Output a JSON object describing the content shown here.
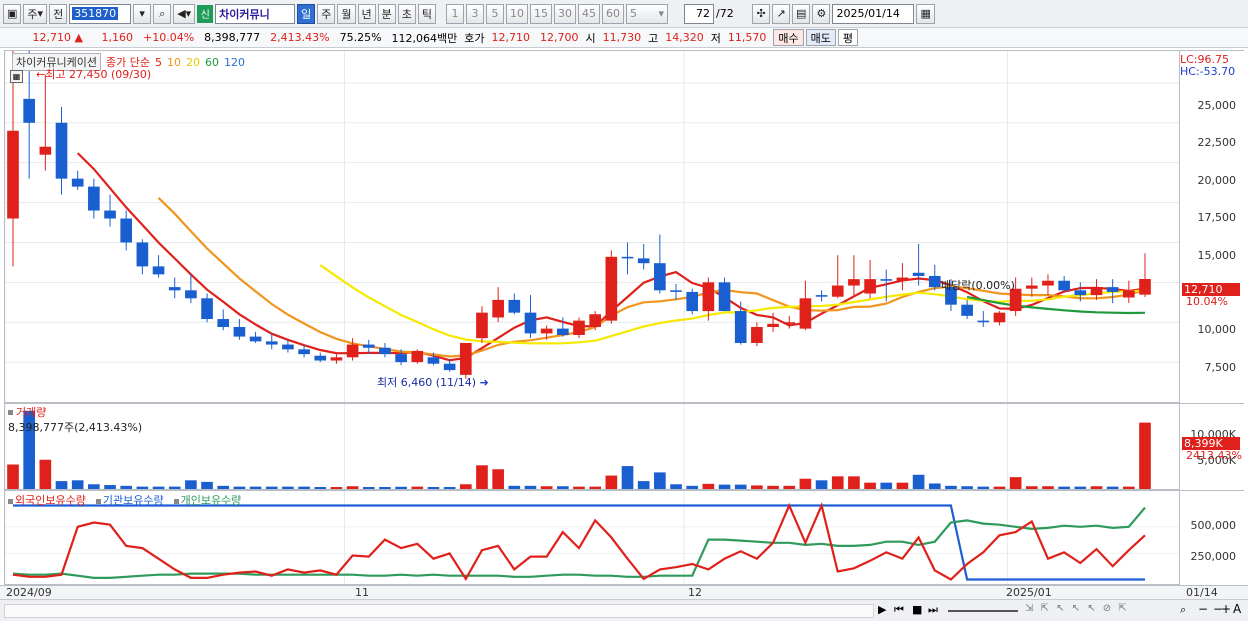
{
  "toolbar": {
    "market": "주",
    "prev": "전",
    "code": "351870",
    "new_badge": "신",
    "stock_name": "차이커뮤니",
    "periods": [
      "일",
      "주",
      "월",
      "년",
      "분",
      "초",
      "틱"
    ],
    "active_period": "일",
    "intervals": [
      "1",
      "3",
      "5",
      "10",
      "15",
      "30",
      "45",
      "60"
    ],
    "interval_select": "5",
    "count": "72",
    "count_total": "/72",
    "date": "2025/01/14"
  },
  "quote": {
    "price": "12,710",
    "change": "1,160",
    "change_pct": "+10.04%",
    "volume": "8,398,777",
    "volume_ratio": "2,413.43%",
    "turnover": "75.25%",
    "amount": "112,064백만",
    "hoga_label": "호가",
    "ask": "12,710",
    "bid": "12,700",
    "open_label": "시",
    "open": "11,730",
    "high_label": "고",
    "high": "14,320",
    "low_label": "저",
    "low": "11,570",
    "buy": "매수",
    "sell": "매도",
    "avg": "평"
  },
  "main_panel": {
    "stock_name": "차이커뮤니케이션",
    "legend_prefix": "종가 단순",
    "ma_periods": [
      "5",
      "10",
      "20",
      "60",
      "120"
    ],
    "ma_colors": [
      "#e0201a",
      "#f0961e",
      "#f5e900",
      "#1e9a3c",
      "#2a6fd6"
    ],
    "high_note": "←최고 27,450 (09/30)",
    "low_note": "최저 6,460 (11/14)",
    "dividend_note": "배당락(0.00%)",
    "lc": "LC:96.75",
    "hc": "HC:-53.70",
    "price_tag": "12,710",
    "pct_tag": "10.04%",
    "y_ticks": [
      "25,000",
      "22,500",
      "20,000",
      "17,500",
      "15,000",
      "12,500",
      "10,000",
      "7,500"
    ]
  },
  "volume_panel": {
    "title": "거래량",
    "current": "8,398,777주(2,413.43%)",
    "tick": "10,000K",
    "tick2": "5,000K",
    "tag_value": "8,399K",
    "tag_pct": "2413.43%"
  },
  "holding_panel": {
    "legends": [
      "외국인보유수량",
      "기관보유수량",
      "개인보유수량"
    ],
    "legend_colors": [
      "#e0201a",
      "#1e5fd6",
      "#2e9a5c"
    ],
    "y_ticks": [
      "500,000",
      "250,000"
    ]
  },
  "x_axis": {
    "labels": [
      "2024/09",
      "11",
      "12",
      "2025/01"
    ],
    "right_label": "01/14"
  },
  "chart_data": {
    "type": "candlestick",
    "title": "차이커뮤니케이션",
    "ylim": [
      5000,
      27000
    ],
    "candles": [
      [
        16500,
        27450,
        13500,
        22000
      ],
      [
        24000,
        27000,
        19000,
        22500
      ],
      [
        20500,
        25500,
        19500,
        21000
      ],
      [
        22500,
        23500,
        18000,
        19000
      ],
      [
        19000,
        19500,
        18300,
        18500
      ],
      [
        18500,
        19000,
        16500,
        17000
      ],
      [
        17000,
        18000,
        16000,
        16500
      ],
      [
        16500,
        17000,
        14500,
        15000
      ],
      [
        15000,
        15200,
        13000,
        13500
      ],
      [
        13500,
        14200,
        12800,
        13000
      ],
      [
        12200,
        12800,
        11500,
        12000
      ],
      [
        12000,
        13000,
        11200,
        11500
      ],
      [
        11500,
        11800,
        10000,
        10200
      ],
      [
        10200,
        10800,
        9500,
        9700
      ],
      [
        9700,
        10200,
        8900,
        9100
      ],
      [
        9100,
        9400,
        8700,
        8800
      ],
      [
        8800,
        9300,
        8300,
        8600
      ],
      [
        8600,
        8900,
        8100,
        8300
      ],
      [
        8300,
        8600,
        7800,
        8000
      ],
      [
        7900,
        8100,
        7500,
        7600
      ],
      [
        7600,
        8000,
        7400,
        7800
      ],
      [
        7800,
        9000,
        7600,
        8600
      ],
      [
        8600,
        8900,
        8000,
        8400
      ],
      [
        8400,
        8700,
        7800,
        8000
      ],
      [
        8000,
        8300,
        7300,
        7500
      ],
      [
        7500,
        8300,
        7400,
        8200
      ],
      [
        7800,
        8100,
        7300,
        7400
      ],
      [
        7400,
        7700,
        6900,
        7000
      ],
      [
        6700,
        8700,
        6460,
        8700
      ],
      [
        9000,
        11000,
        8700,
        10600
      ],
      [
        10300,
        12200,
        10000,
        11400
      ],
      [
        11400,
        11800,
        10500,
        10600
      ],
      [
        10600,
        11700,
        9000,
        9300
      ],
      [
        9300,
        9800,
        8900,
        9600
      ],
      [
        9600,
        10300,
        9100,
        9200
      ],
      [
        9200,
        10300,
        9000,
        10100
      ],
      [
        9700,
        10700,
        9500,
        10500
      ],
      [
        10100,
        14500,
        9900,
        14100
      ],
      [
        14100,
        15000,
        13000,
        14000
      ],
      [
        14000,
        14900,
        13300,
        13700
      ],
      [
        13700,
        15500,
        11800,
        12000
      ],
      [
        12000,
        12400,
        11400,
        11900
      ],
      [
        11900,
        12100,
        10500,
        10700
      ],
      [
        10700,
        12800,
        10100,
        12500
      ],
      [
        12500,
        12800,
        10700,
        10700
      ],
      [
        10700,
        11300,
        8600,
        8700
      ],
      [
        8700,
        10000,
        8500,
        9700
      ],
      [
        9700,
        10600,
        9400,
        9900
      ],
      [
        9900,
        10400,
        9600,
        10000
      ],
      [
        9600,
        12600,
        9500,
        11500
      ],
      [
        11700,
        12000,
        11300,
        11600
      ],
      [
        11600,
        14200,
        11500,
        12300
      ],
      [
        12300,
        14200,
        11700,
        12700
      ],
      [
        11800,
        13900,
        11500,
        12700
      ],
      [
        12700,
        13300,
        11300,
        12600
      ],
      [
        12600,
        13700,
        12000,
        12800
      ],
      [
        13100,
        14900,
        12300,
        12900
      ],
      [
        12900,
        13600,
        12000,
        12200
      ],
      [
        12200,
        12700,
        10700,
        11100
      ],
      [
        11100,
        11400,
        10200,
        10400
      ],
      [
        10100,
        10700,
        9700,
        10000
      ],
      [
        10000,
        10700,
        9800,
        10600
      ],
      [
        10700,
        12800,
        10400,
        12100
      ],
      [
        12100,
        12800,
        11600,
        12300
      ],
      [
        12300,
        13000,
        11700,
        12600
      ],
      [
        12600,
        12900,
        11900,
        12000
      ],
      [
        12000,
        12500,
        11300,
        11700
      ],
      [
        11700,
        12700,
        11400,
        12200
      ],
      [
        12200,
        12700,
        11200,
        11900
      ],
      [
        11550,
        12600,
        11200,
        12000
      ],
      [
        11730,
        14320,
        11570,
        12710
      ]
    ],
    "volume": [
      3100,
      9900,
      3700,
      1000,
      1100,
      600,
      500,
      400,
      300,
      300,
      300,
      1100,
      900,
      400,
      300,
      300,
      300,
      300,
      300,
      250,
      250,
      350,
      250,
      250,
      280,
      300,
      250,
      250,
      600,
      3000,
      2500,
      400,
      400,
      350,
      350,
      300,
      300,
      1700,
      2900,
      1000,
      2100,
      600,
      400,
      650,
      550,
      550,
      450,
      400,
      400,
      1300,
      1100,
      1600,
      1600,
      800,
      800,
      800,
      1800,
      700,
      400,
      350,
      300,
      300,
      1500,
      350,
      350,
      300,
      300,
      350,
      300,
      300,
      8399
    ],
    "holding": {
      "foreign": [
        50,
        30,
        30,
        50,
        500,
        540,
        520,
        320,
        300,
        200,
        100,
        20,
        20,
        50,
        70,
        80,
        40,
        100,
        70,
        90,
        50,
        230,
        220,
        380,
        300,
        340,
        200,
        250,
        10,
        280,
        320,
        100,
        220,
        220,
        450,
        300,
        560,
        400,
        200,
        10,
        100,
        120,
        150,
        100,
        200,
        270,
        200,
        350,
        700,
        350,
        700,
        80,
        110,
        180,
        260,
        200,
        400,
        90,
        5,
        150,
        260,
        420,
        450,
        550,
        200,
        260,
        160,
        290,
        130,
        280,
        420
      ],
      "institution": [
        700,
        700,
        700,
        700,
        700,
        700,
        700,
        700,
        700,
        700,
        700,
        700,
        700,
        700,
        700,
        700,
        700,
        700,
        700,
        700,
        700,
        700,
        700,
        700,
        700,
        700,
        700,
        700,
        700,
        700,
        700,
        700,
        700,
        700,
        700,
        700,
        700,
        700,
        700,
        700,
        700,
        700,
        700,
        700,
        700,
        700,
        700,
        700,
        700,
        700,
        700,
        700,
        700,
        700,
        700,
        700,
        700,
        700,
        700,
        5,
        5,
        5,
        5,
        5,
        5,
        5,
        5,
        5,
        5,
        5,
        5
      ],
      "individual": [
        60,
        50,
        50,
        60,
        40,
        20,
        20,
        30,
        40,
        50,
        50,
        60,
        60,
        60,
        60,
        50,
        50,
        50,
        50,
        50,
        50,
        50,
        40,
        40,
        50,
        40,
        50,
        40,
        40,
        40,
        40,
        30,
        30,
        40,
        50,
        50,
        40,
        40,
        30,
        30,
        40,
        40,
        40,
        380,
        380,
        370,
        360,
        350,
        350,
        330,
        340,
        320,
        320,
        330,
        360,
        360,
        330,
        360,
        540,
        560,
        530,
        520,
        500,
        480,
        490,
        510,
        500,
        510,
        490,
        500,
        680
      ]
    }
  }
}
